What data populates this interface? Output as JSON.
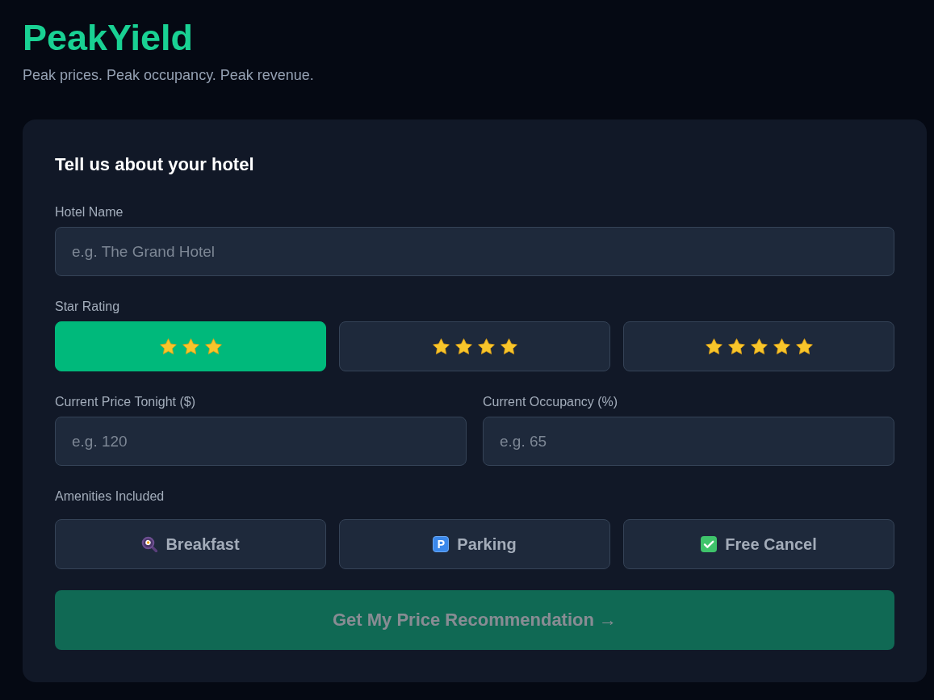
{
  "header": {
    "title": "PeakYield",
    "tagline": "Peak prices. Peak occupancy. Peak revenue."
  },
  "form": {
    "heading": "Tell us about your hotel",
    "hotel_name": {
      "label": "Hotel Name",
      "placeholder": "e.g. The Grand Hotel"
    },
    "star_rating": {
      "label": "Star Rating",
      "options": [
        {
          "stars": 3,
          "selected": true
        },
        {
          "stars": 4,
          "selected": false
        },
        {
          "stars": 5,
          "selected": false
        }
      ]
    },
    "price": {
      "label": "Current Price Tonight ($)",
      "placeholder": "e.g. 120"
    },
    "occupancy": {
      "label": "Current Occupancy (%)",
      "placeholder": "e.g. 65"
    },
    "amenities": {
      "label": "Amenities Included",
      "items": [
        {
          "label": "Breakfast",
          "selected": false
        },
        {
          "label": "Parking",
          "icon": "P",
          "selected": false
        },
        {
          "label": "Free Cancel",
          "selected": false
        }
      ]
    },
    "submit": {
      "label": "Get My Price Recommendation →",
      "disabled": true
    }
  }
}
